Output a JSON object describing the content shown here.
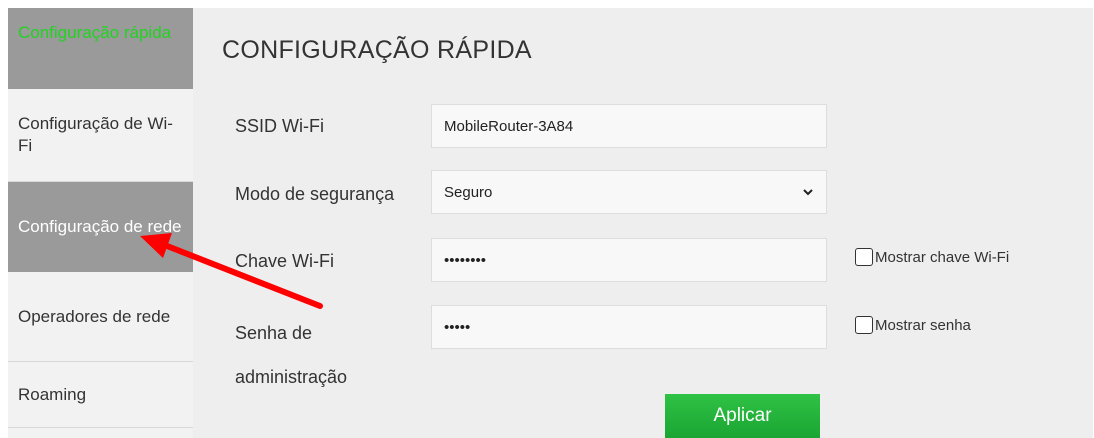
{
  "sidebar": {
    "items": [
      {
        "label": "Configuração rápida"
      },
      {
        "label": "Configuração de Wi-Fi"
      },
      {
        "label": "Configuração de rede"
      },
      {
        "label": "Operadores de rede"
      },
      {
        "label": "Roaming"
      }
    ]
  },
  "main": {
    "title": "CONFIGURAÇÃO RÁPIDA",
    "ssid": {
      "label": "SSID Wi-Fi",
      "value": "MobileRouter-3A84"
    },
    "security": {
      "label": "Modo de segurança",
      "value": "Seguro"
    },
    "wifi_key": {
      "label": "Chave Wi-Fi",
      "value": "••••••••",
      "show_label": "Mostrar chave Wi-Fi"
    },
    "admin_password": {
      "label": "Senha de administração",
      "value": "•••••",
      "show_label": "Mostrar senha"
    },
    "apply_label": "Aplicar"
  },
  "colors": {
    "active_text": "#21d321",
    "sidebar_highlight": "#9a9a9a",
    "apply_button": "#1fae38",
    "annotation_arrow": "#ff0000"
  },
  "icons": {
    "select_caret": "chevron-down-icon",
    "annotation": "red-arrow-icon"
  }
}
